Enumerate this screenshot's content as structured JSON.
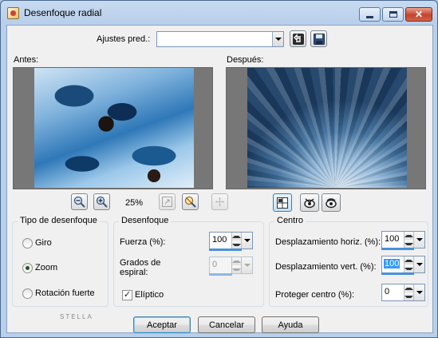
{
  "window": {
    "title": "Desenfoque radial",
    "close_glyph": "✕"
  },
  "presets": {
    "label": "Ajustes pred.:",
    "value": ""
  },
  "preview": {
    "before_label": "Antes:",
    "after_label": "Después:",
    "zoom_level": "25%"
  },
  "blur_type": {
    "title": "Tipo de desenfoque",
    "options": [
      "Giro",
      "Zoom",
      "Rotación fuerte"
    ],
    "selected": "Zoom"
  },
  "blur": {
    "title": "Desenfoque",
    "strength_label": "Fuerza (%):",
    "strength_value": "100",
    "spiral_label_1": "Grados de",
    "spiral_label_2": "espiral:",
    "spiral_value": "0",
    "elliptical_label": "Elíptico",
    "elliptical_checked": true,
    "check_glyph": "✓"
  },
  "center": {
    "title": "Centro",
    "horiz_label": "Desplazamiento horiz. (%):",
    "horiz_value": "100",
    "vert_label": "Desplazamiento vert. (%):",
    "vert_value": "100",
    "protect_label": "Proteger centro (%):",
    "protect_value": "0"
  },
  "footer": {
    "watermark": "STELLA",
    "ok_label": "Aceptar",
    "cancel_label": "Cancelar",
    "help_label": "Ayuda"
  },
  "colors": {
    "accent": "#4a90d9",
    "selection": "#3399ff",
    "close": "#c6432b"
  }
}
